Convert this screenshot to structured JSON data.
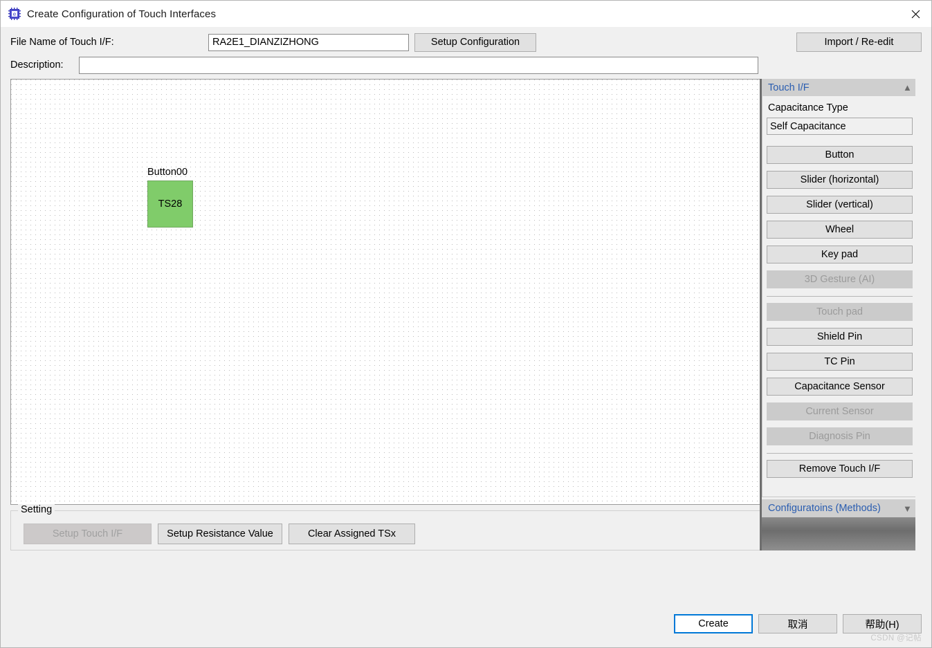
{
  "window": {
    "title": "Create Configuration of Touch Interfaces",
    "icon": "app-chip-icon",
    "close_icon": "close-icon",
    "accent_color": "#0078d7",
    "element_color": "#80cc6a"
  },
  "form": {
    "file_label": "File Name of Touch I/F:",
    "file_value": "RA2E1_DIANZIZHONG",
    "file_placeholder": "",
    "setup_config_label": "Setup Configuration",
    "import_label": "Import / Re-edit",
    "description_label": "Description:",
    "description_value": "",
    "description_placeholder": ""
  },
  "canvas": {
    "elements": [
      {
        "label": "Button00",
        "pin": "TS28"
      }
    ]
  },
  "setting": {
    "legend": "Setting",
    "buttons": [
      {
        "label": "Setup Touch I/F",
        "disabled": true
      },
      {
        "label": "Setup Resistance Value",
        "disabled": false
      },
      {
        "label": "Clear Assigned TSx",
        "disabled": false
      }
    ]
  },
  "panel": {
    "touch_if": {
      "header": "Touch I/F",
      "collapse_icon": "chevron-double-up-icon",
      "capacitance_type_label": "Capacitance Type",
      "capacitance_type_value": "Self Capacitance",
      "buttons": [
        {
          "label": "Button",
          "disabled": false
        },
        {
          "label": "Slider (horizontal)",
          "disabled": false
        },
        {
          "label": "Slider (vertical)",
          "disabled": false
        },
        {
          "label": "Wheel",
          "disabled": false
        },
        {
          "label": "Key pad",
          "disabled": false
        },
        {
          "label": "3D Gesture (AI)",
          "disabled": true
        },
        {
          "separator": true
        },
        {
          "label": "Touch pad",
          "disabled": true
        },
        {
          "label": "Shield Pin",
          "disabled": false
        },
        {
          "label": "TC Pin",
          "disabled": false
        },
        {
          "label": "Capacitance Sensor",
          "disabled": false
        },
        {
          "label": "Current Sensor",
          "disabled": true
        },
        {
          "label": "Diagnosis Pin",
          "disabled": true
        },
        {
          "separator": true
        },
        {
          "label": "Remove Touch I/F",
          "disabled": false
        }
      ]
    },
    "configurations": {
      "header": "Configuratoins (Methods)",
      "expand_icon": "chevron-double-down-icon"
    }
  },
  "footer": {
    "create_label": "Create",
    "cancel_label": "取消",
    "help_label": "帮助(H)",
    "watermark": "CSDN @记帖"
  }
}
